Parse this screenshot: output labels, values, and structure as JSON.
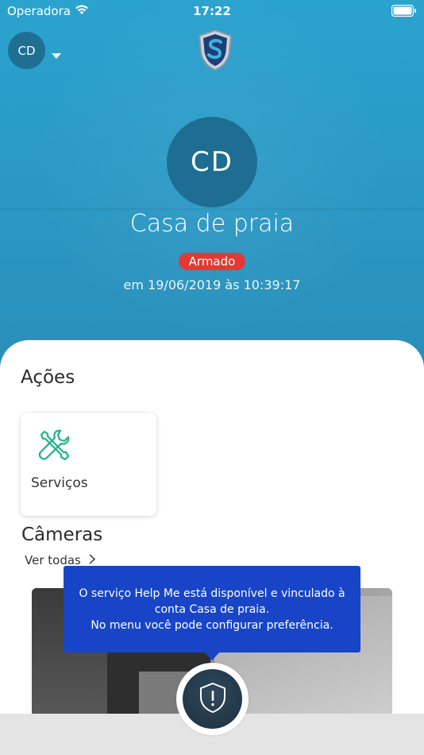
{
  "statusbar": {
    "carrier": "Operadora",
    "time": "17:22"
  },
  "header": {
    "avatar_initials": "CD"
  },
  "profile": {
    "initials": "CD",
    "place_name": "Casa de praia",
    "status": "Armado",
    "status_color": "#e23a32",
    "timestamp": "em 19/06/2019 às 10:39:17"
  },
  "actions": {
    "title": "Ações",
    "items": [
      {
        "label": "Serviços",
        "icon": "tools-icon"
      }
    ]
  },
  "cameras": {
    "title": "Câmeras",
    "see_all": "Ver todas"
  },
  "tooltip": {
    "line1": "O serviço Help Me está disponível e vinculado à",
    "line2_pre": "conta ",
    "line2_bold": "Casa de praia.",
    "line3_pre": "No ",
    "line3_bold": "menu",
    "line3_post": " você pode configurar preferência."
  },
  "colors": {
    "accent": "#2aa3cf",
    "tooltip_bg": "#1845c8",
    "icon_green": "#1fb38a"
  }
}
